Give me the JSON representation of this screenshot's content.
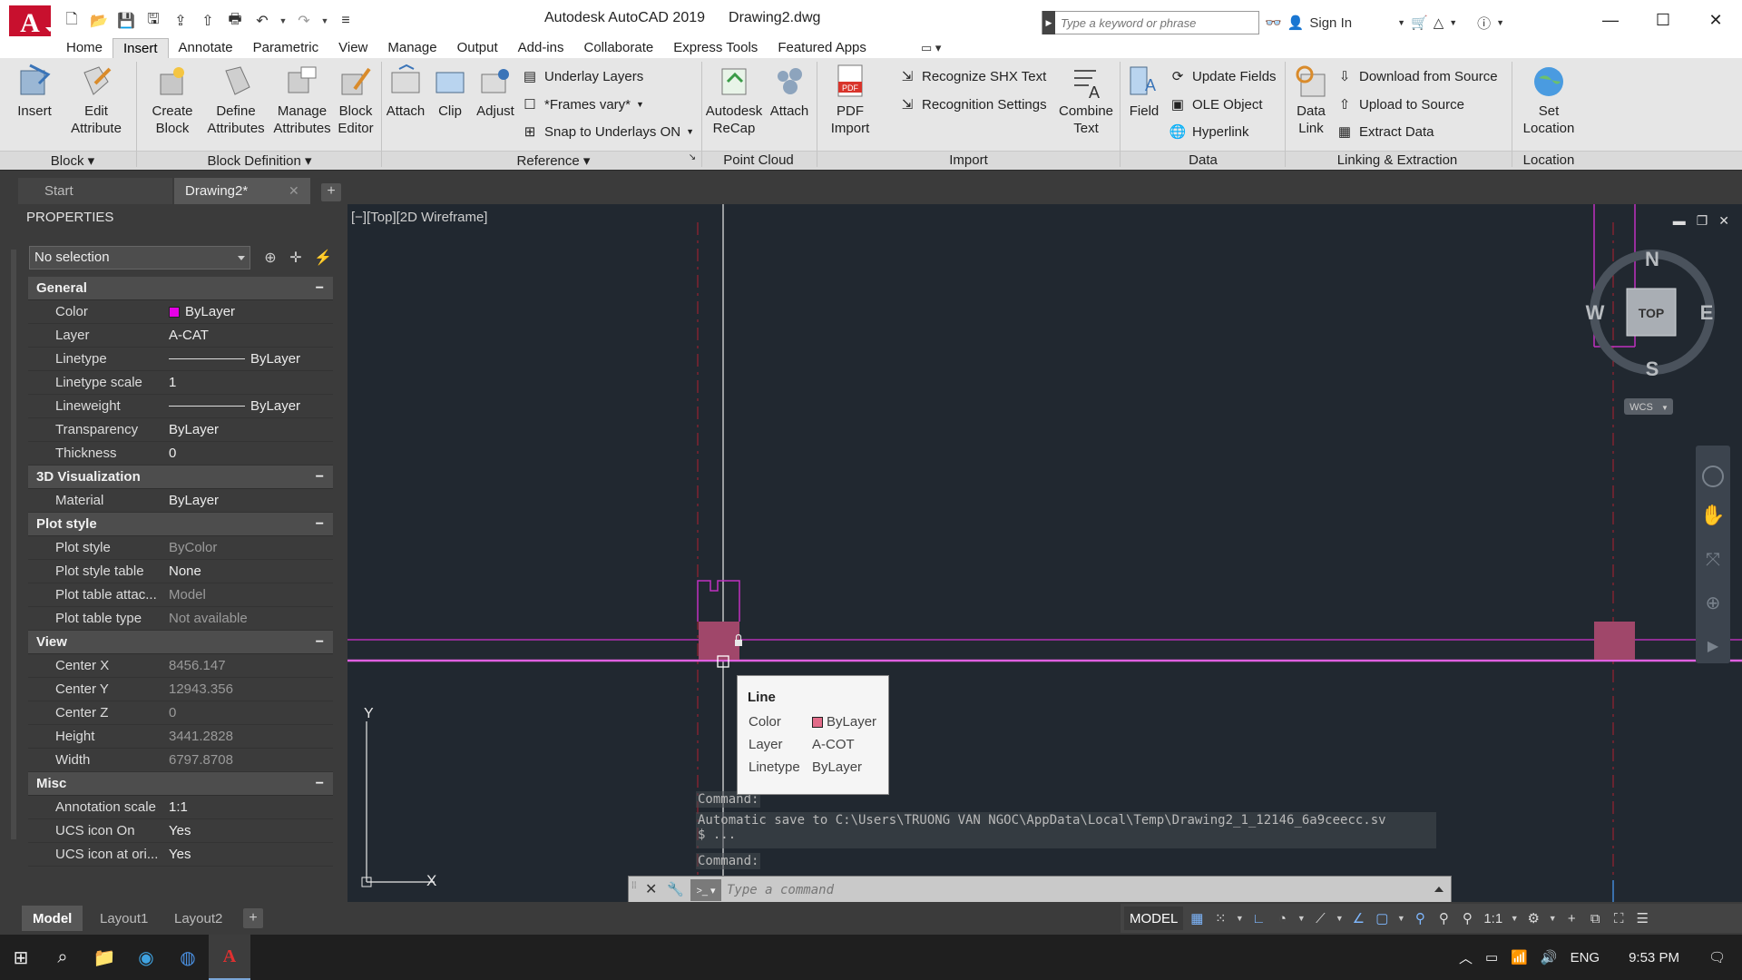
{
  "app": {
    "title": "Autodesk AutoCAD 2019",
    "document": "Drawing2.dwg",
    "logo_letter": "A",
    "search_placeholder": "Type a keyword or phrase",
    "sign_in": "Sign In"
  },
  "ribbon_tabs": [
    "Home",
    "Insert",
    "Annotate",
    "Parametric",
    "View",
    "Manage",
    "Output",
    "Add-ins",
    "Collaborate",
    "Express Tools",
    "Featured Apps"
  ],
  "ribbon": {
    "insert": "Insert",
    "edit_attribute": [
      "Edit",
      "Attribute"
    ],
    "create_block": [
      "Create",
      "Block"
    ],
    "define_attributes": [
      "Define",
      "Attributes"
    ],
    "manage_attributes": [
      "Manage",
      "Attributes"
    ],
    "block_editor": [
      "Block",
      "Editor"
    ],
    "attach": "Attach",
    "clip": "Clip",
    "adjust": "Adjust",
    "underlay_layers": "Underlay Layers",
    "frames_vary": "*Frames vary*",
    "snap_underlays": "Snap to Underlays ON",
    "autodesk_recap": [
      "Autodesk",
      "ReCap"
    ],
    "attach_pc": "Attach",
    "pdf_import": [
      "PDF",
      "Import"
    ],
    "recognize_shx": "Recognize SHX Text",
    "recognition_settings": "Recognition Settings",
    "combine_text": [
      "Combine",
      "Text"
    ],
    "field": "Field",
    "update_fields": "Update Fields",
    "ole_object": "OLE Object",
    "hyperlink": "Hyperlink",
    "data_link": [
      "Data",
      "Link"
    ],
    "download_source": "Download from Source",
    "upload_source": "Upload to Source",
    "extract_data": "Extract  Data",
    "set_location": [
      "Set",
      "Location"
    ],
    "pdf_badge": "PDF",
    "panels": {
      "block": "Block",
      "block_definition": "Block Definition",
      "reference": "Reference",
      "point_cloud": "Point Cloud",
      "import": "Import",
      "data": "Data",
      "linking": "Linking & Extraction",
      "location": "Location"
    }
  },
  "doc_tabs": {
    "start": "Start",
    "drawing": "Drawing2*"
  },
  "properties": {
    "title": "PROPERTIES",
    "selection": "No selection",
    "categories": [
      {
        "name": "General",
        "rows": [
          {
            "k": "Color",
            "v": "ByLayer",
            "swatch": "#e600e6"
          },
          {
            "k": "Layer",
            "v": "A-CAT"
          },
          {
            "k": "Linetype",
            "v": "ByLayer",
            "line": true
          },
          {
            "k": "Linetype scale",
            "v": "1"
          },
          {
            "k": "Lineweight",
            "v": "ByLayer",
            "line": true
          },
          {
            "k": "Transparency",
            "v": "ByLayer"
          },
          {
            "k": "Thickness",
            "v": "0"
          }
        ]
      },
      {
        "name": "3D Visualization",
        "rows": [
          {
            "k": "Material",
            "v": "ByLayer"
          }
        ]
      },
      {
        "name": "Plot style",
        "rows": [
          {
            "k": "Plot style",
            "v": "ByColor",
            "ro": true
          },
          {
            "k": "Plot style table",
            "v": "None"
          },
          {
            "k": "Plot table attac...",
            "v": "Model",
            "ro": true
          },
          {
            "k": "Plot table type",
            "v": "Not available",
            "ro": true
          }
        ]
      },
      {
        "name": "View",
        "rows": [
          {
            "k": "Center X",
            "v": "8456.147",
            "ro": true
          },
          {
            "k": "Center Y",
            "v": "12943.356",
            "ro": true
          },
          {
            "k": "Center Z",
            "v": "0",
            "ro": true
          },
          {
            "k": "Height",
            "v": "3441.2828",
            "ro": true
          },
          {
            "k": "Width",
            "v": "6797.8708",
            "ro": true
          }
        ]
      },
      {
        "name": "Misc",
        "rows": [
          {
            "k": "Annotation scale",
            "v": "1:1"
          },
          {
            "k": "UCS icon On",
            "v": "Yes"
          },
          {
            "k": "UCS icon at ori...",
            "v": "Yes"
          }
        ]
      }
    ]
  },
  "viewport": {
    "label": "[−][Top][2D Wireframe]",
    "compass": {
      "n": "N",
      "s": "S",
      "e": "E",
      "w": "W",
      "face": "TOP",
      "wcs": "WCS"
    },
    "ucs_x": "X",
    "ucs_y": "Y"
  },
  "tooltip": {
    "title": "Line",
    "rows": [
      {
        "k": "Color",
        "v": "ByLayer",
        "swatch": "#e26c89"
      },
      {
        "k": "Layer",
        "v": "A-COT"
      },
      {
        "k": "Linetype",
        "v": "ByLayer"
      }
    ]
  },
  "command": {
    "history": [
      "Command:",
      "Automatic save to C:\\Users\\TRUONG VAN NGOC\\AppData\\Local\\Temp\\Drawing2_1_12146_6a9ceecc.sv\n$ ...",
      "Command:"
    ],
    "placeholder": "Type a command"
  },
  "layout_tabs": [
    "Model",
    "Layout1",
    "Layout2"
  ],
  "status": {
    "model": "MODEL",
    "scale": "1:1"
  },
  "tray": {
    "lang": "ENG",
    "time": "9:53 PM"
  },
  "colors": {
    "accent": "#c8102e",
    "drawing_bg": "#212830",
    "magenta": "#c030c0",
    "pink_block": "#a0476a"
  }
}
